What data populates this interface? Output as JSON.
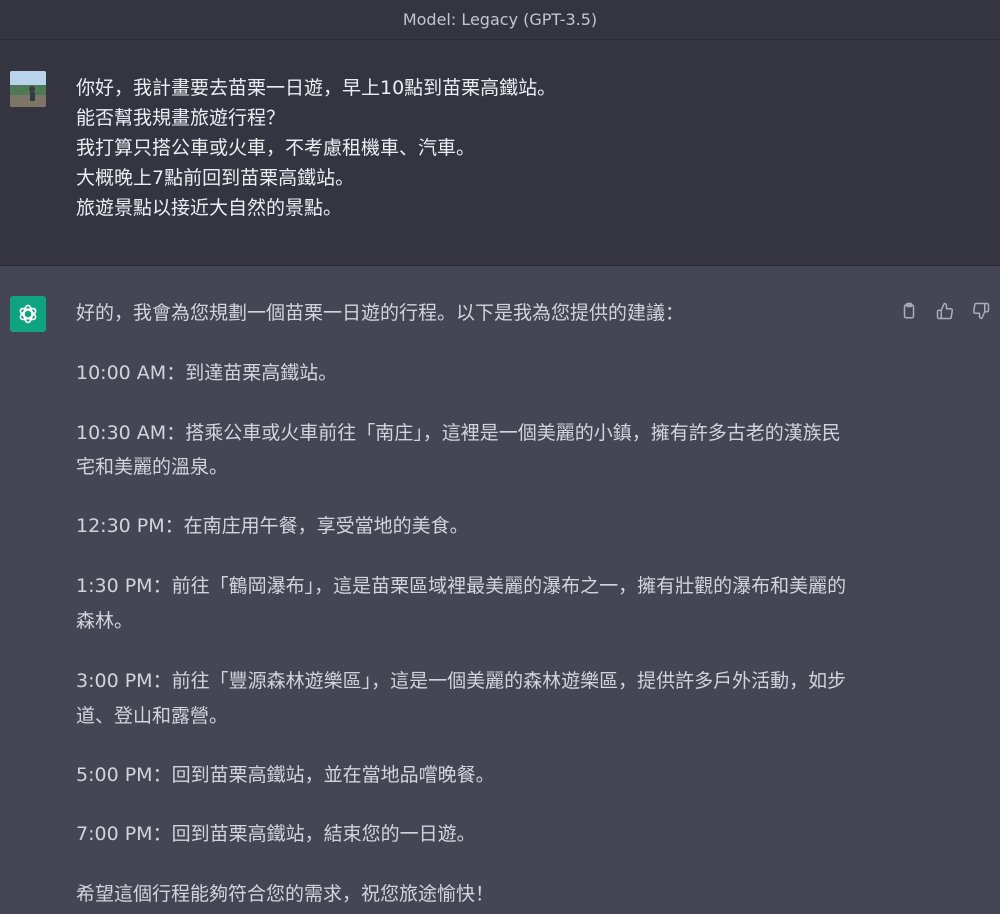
{
  "header": {
    "model_label": "Model: Legacy (GPT-3.5)"
  },
  "user_message": {
    "lines": [
      "你好，我計畫要去苗栗一日遊，早上10點到苗栗高鐵站。",
      "能否幫我規畫旅遊行程？",
      "我打算只搭公車或火車，不考慮租機車、汽車。",
      "大概晚上7點前回到苗栗高鐵站。",
      "旅遊景點以接近大自然的景點。"
    ]
  },
  "assistant_message": {
    "intro": "好的，我會為您規劃一個苗栗一日遊的行程。以下是我為您提供的建議：",
    "items": [
      {
        "time": "10:00 AM",
        "lines": [
          "：到達苗栗高鐵站。"
        ]
      },
      {
        "time": "10:30 AM",
        "lines": [
          "：搭乘公車或火車前往「南庄」，這裡是一個美麗的小鎮，擁有許多古老的漢族民",
          "宅和美麗的溫泉。"
        ]
      },
      {
        "time": "12:30 PM",
        "lines": [
          "：在南庄用午餐，享受當地的美食。"
        ]
      },
      {
        "time": "1:30 PM",
        "lines": [
          "：前往「鶴岡瀑布」，這是苗栗區域裡最美麗的瀑布之一，擁有壯觀的瀑布和美麗的",
          "森林。"
        ]
      },
      {
        "time": "3:00 PM",
        "lines": [
          "：前往「豐源森林遊樂區」，這是一個美麗的森林遊樂區，提供許多戶外活動，如步",
          "道、登山和露營。"
        ]
      },
      {
        "time": "5:00 PM",
        "lines": [
          "：回到苗栗高鐵站，並在當地品嚐晚餐。"
        ]
      },
      {
        "time": "7:00 PM",
        "lines": [
          "：回到苗栗高鐵站，結束您的一日遊。"
        ]
      }
    ],
    "closing": "希望這個行程能夠符合您的需求，祝您旅途愉快！"
  },
  "icons": {
    "copy": "clipboard-icon",
    "thumbs_up": "thumbs-up-icon",
    "thumbs_down": "thumbs-down-icon",
    "bot": "openai-logo-icon"
  },
  "colors": {
    "bot_avatar_bg": "#10a37f",
    "user_bg": "#343541",
    "assistant_bg": "#444654"
  }
}
